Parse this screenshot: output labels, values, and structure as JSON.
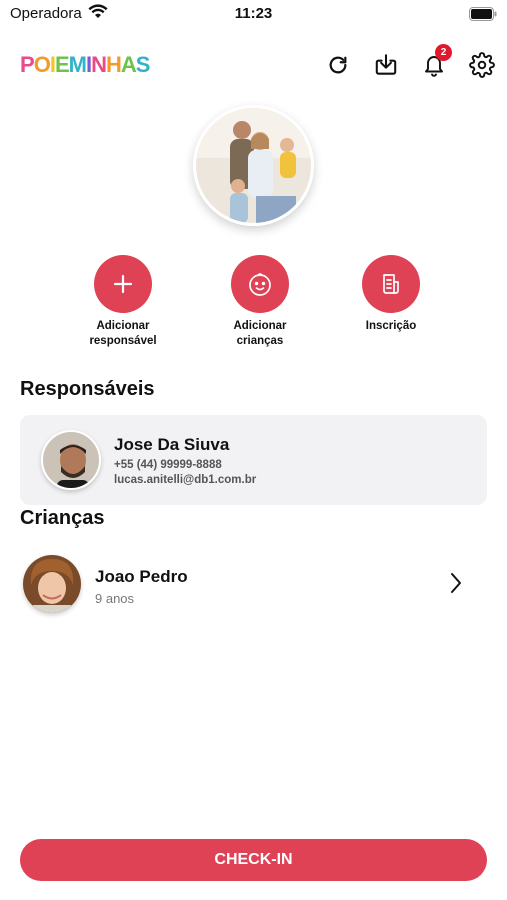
{
  "status_bar": {
    "carrier": "Operadora",
    "time": "11:23"
  },
  "header": {
    "logo": "POIEMINHAS",
    "logo_colors": [
      "#e84a8a",
      "#f29a2e",
      "#f3c623",
      "#6cc24a",
      "#33b2c9",
      "#7d5bc6",
      "#e84a8a",
      "#f29a2e",
      "#6cc24a",
      "#33b2c9"
    ],
    "notification_count": "2",
    "icons": [
      "refresh-icon",
      "download-icon",
      "bell-icon",
      "gear-icon"
    ]
  },
  "actions": [
    {
      "label_line1": "Adicionar",
      "label_line2": "responsável",
      "icon": "plus-icon"
    },
    {
      "label_line1": "Adicionar",
      "label_line2": "crianças",
      "icon": "baby-face-icon"
    },
    {
      "label_line1": "Inscrição",
      "label_line2": "",
      "icon": "document-icon"
    }
  ],
  "sections": {
    "responsaveis": "Responsáveis",
    "criancas": "Crianças"
  },
  "responsavel": {
    "name": "Jose Da Siuva",
    "phone": "+55 (44) 99999-8888",
    "email": "lucas.anitelli@db1.com.br"
  },
  "child": {
    "name": "Joao Pedro",
    "age": "9 anos"
  },
  "checkin_label": "CHECK-IN",
  "colors": {
    "accent": "#df4155",
    "card_bg": "#f2f2f4",
    "badge": "#e0192f"
  }
}
